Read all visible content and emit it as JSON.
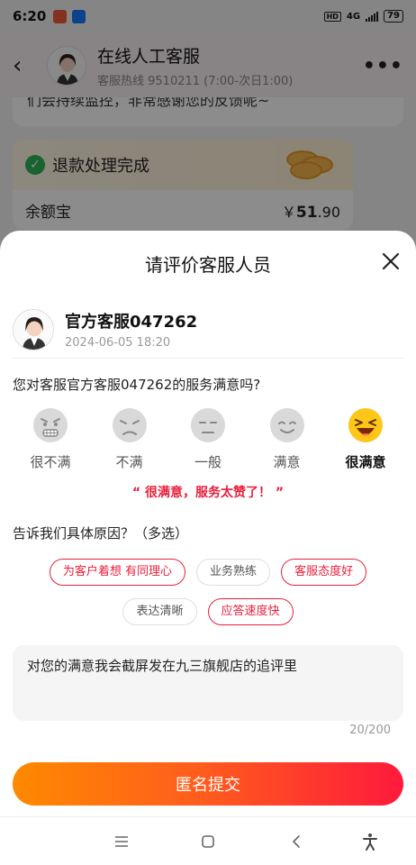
{
  "status_bar": {
    "time": "6:20",
    "network": "4G",
    "battery": "79",
    "hd": "HD"
  },
  "chat_header": {
    "title": "在线人工客服",
    "subtitle": "客服热线 9510211 (7:00-次日1:00)"
  },
  "background_chat": {
    "partial_message": "们会持续监控，非常感谢您的反馈呢~",
    "refund_card": {
      "title": "退款处理完成",
      "method": "余额宝",
      "amount_symbol": "￥",
      "amount_int": "51",
      "amount_dec": ".90"
    }
  },
  "rating_sheet": {
    "title": "请评价客服人员",
    "agent_name": "官方客服047262",
    "date": "2024-06-05 18:20",
    "question": "您对客服官方客服047262的服务满意吗?",
    "ratings": [
      {
        "label": "很不满",
        "face": "very-unhappy-face-icon"
      },
      {
        "label": "不满",
        "face": "unhappy-face-icon"
      },
      {
        "label": "一般",
        "face": "neutral-face-icon"
      },
      {
        "label": "满意",
        "face": "happy-face-icon"
      },
      {
        "label": "很满意",
        "face": "very-happy-face-icon"
      }
    ],
    "selected_rating": "很满意",
    "feedback_message": "“ 很满意，服务太赞了！ ”",
    "reason_title": "告诉我们具体原因？（多选）",
    "tags": [
      {
        "label": "为客户着想 有同理心",
        "selected": true
      },
      {
        "label": "业务熟练",
        "selected": false
      },
      {
        "label": "客服态度好",
        "selected": true
      },
      {
        "label": "表达清晰",
        "selected": false
      },
      {
        "label": "应答速度快",
        "selected": true
      }
    ],
    "comment": "对您的满意我会截屏发在九三旗舰店的追评里",
    "counter": "20/200",
    "submit_label": "匿名提交"
  },
  "colors": {
    "accent": "#e8203c",
    "gradient_start": "#ff8a00",
    "gradient_end": "#ff1a3c"
  }
}
